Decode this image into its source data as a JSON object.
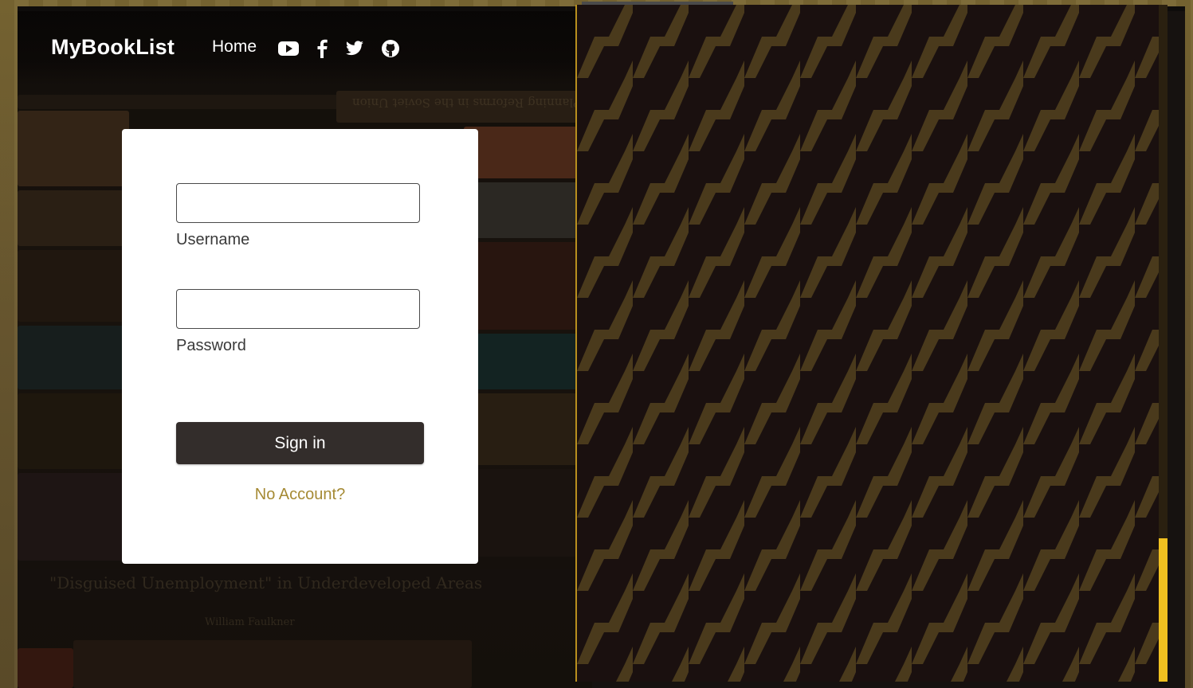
{
  "app": {
    "brand": "MyBookList"
  },
  "nav": {
    "home_label": "Home",
    "icons": [
      "youtube-icon",
      "facebook-icon",
      "twitter-icon",
      "github-icon"
    ]
  },
  "login": {
    "username_label": "Username",
    "username_value": "",
    "password_label": "Password",
    "password_value": "",
    "signin_label": "Sign in",
    "no_account_label": "No Account?"
  },
  "background_text": {
    "spine_1": "Planning Reforms in the Soviet Union",
    "spine_2": "\"Disguised Unemployment\" in Underdeveloped Areas",
    "spine_3": "William Faulkner"
  },
  "colors": {
    "accent": "#a58a34",
    "button": "#332d2b",
    "pattern_dark": "#1a100f",
    "pattern_light": "#4a3a1c",
    "scroll_thumb": "#f0c020"
  }
}
